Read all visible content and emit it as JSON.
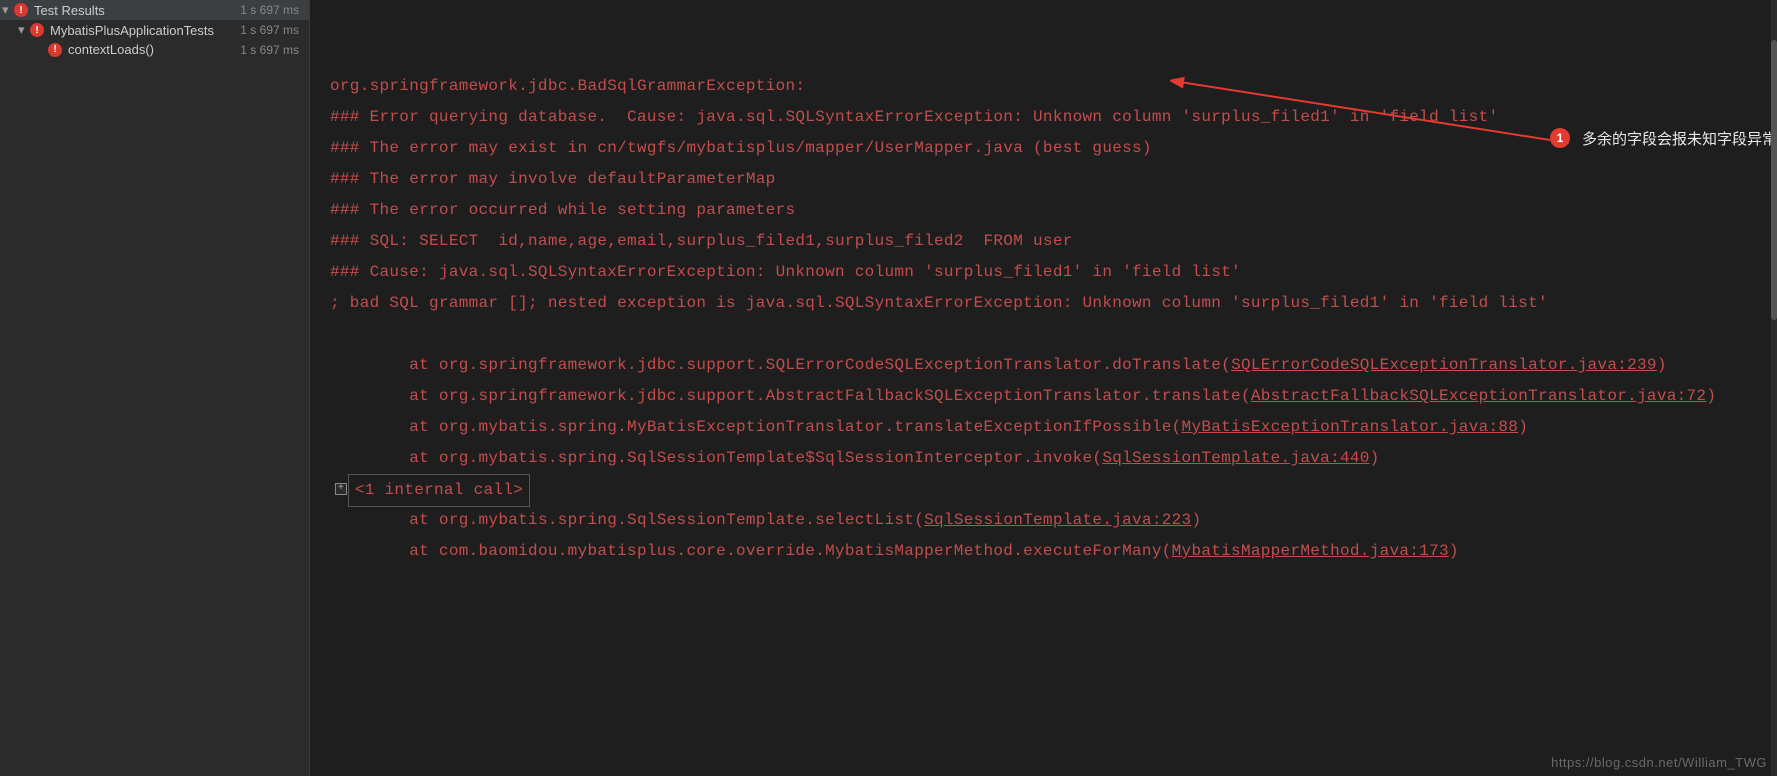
{
  "tree": {
    "root": {
      "label": "Test Results",
      "time": "1 s 697 ms"
    },
    "suite": {
      "label": "MybatisPlusApplicationTests",
      "time": "1 s 697 ms"
    },
    "test": {
      "label": "contextLoads()",
      "time": "1 s 697 ms"
    }
  },
  "console": {
    "l01": "org.springframework.jdbc.BadSqlGrammarException: ",
    "l02": "### Error querying database.  Cause: java.sql.SQLSyntaxErrorException: Unknown column 'surplus_filed1' in 'field list'",
    "l03": "### The error may exist in cn/twgfs/mybatisplus/mapper/UserMapper.java (best guess)",
    "l04": "### The error may involve defaultParameterMap",
    "l05": "### The error occurred while setting parameters",
    "l06": "### SQL: SELECT  id,name,age,email,surplus_filed1,surplus_filed2  FROM user",
    "l07": "### Cause: java.sql.SQLSyntaxErrorException: Unknown column 'surplus_filed1' in 'field list'",
    "l08": "; bad SQL grammar []; nested exception is java.sql.SQLSyntaxErrorException: Unknown column 'surplus_filed1' in 'field list'",
    "l09": "",
    "st1a": "\tat org.springframework.jdbc.support.SQLErrorCodeSQLExceptionTranslator.doTranslate(",
    "st1b": "SQLErrorCodeSQLExceptionTranslator.java:239",
    "st1c": ")",
    "st2a": "\tat org.springframework.jdbc.support.AbstractFallbackSQLExceptionTranslator.translate(",
    "st2b": "AbstractFallbackSQLExceptionTranslator.java:72",
    "st2c": ")",
    "st3a": "\tat org.mybatis.spring.MyBatisExceptionTranslator.translateExceptionIfPossible(",
    "st3b": "MyBatisExceptionTranslator.java:88",
    "st3c": ")",
    "st4a": "\tat org.mybatis.spring.SqlSessionTemplate$SqlSessionInterceptor.invoke(",
    "st4b": "SqlSessionTemplate.java:440",
    "st4c": ")",
    "fold": "<1 internal call>",
    "st5a": "\tat org.mybatis.spring.SqlSessionTemplate.selectList(",
    "st5b": "SqlSessionTemplate.java:223",
    "st5c": ")",
    "st6a": "\tat com.baomidou.mybatisplus.core.override.MybatisMapperMethod.executeForMany(",
    "st6b": "MybatisMapperMethod.java:173",
    "st6c": ")"
  },
  "annotation": {
    "bubble": "1",
    "text": "多余的字段会报未知字段异常"
  },
  "watermark": "https://blog.csdn.net/William_TWG"
}
